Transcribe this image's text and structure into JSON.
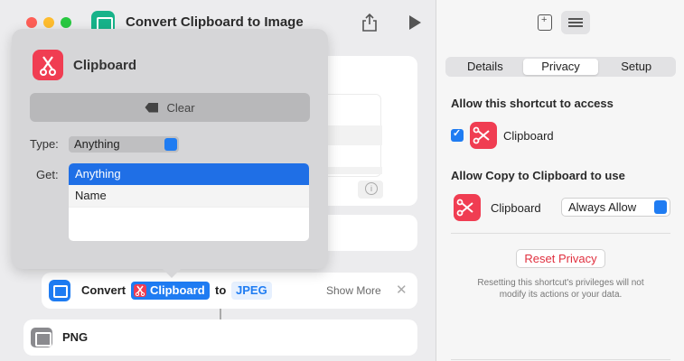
{
  "window": {
    "title": "Convert Clipboard to Image"
  },
  "popover": {
    "title": "Clipboard",
    "clear_label": "Clear",
    "type_label": "Type:",
    "type_value": "Anything",
    "get_label": "Get:",
    "get_options": [
      "Anything",
      "Name"
    ],
    "selected_option": "Anything"
  },
  "action": {
    "convert_label": "Convert",
    "clipboard_token": "Clipboard",
    "to_label": "to",
    "format_token": "JPEG",
    "show_more_label": "Show More"
  },
  "next_action": {
    "label": "PNG"
  },
  "inspector": {
    "tabs": [
      "Details",
      "Privacy",
      "Setup"
    ],
    "active_tab": "Privacy",
    "access_title": "Allow this shortcut to access",
    "access_item_label": "Clipboard",
    "access_checked": true,
    "copy_title": "Allow Copy to Clipboard to use",
    "copy_item_label": "Clipboard",
    "copy_permission_value": "Always Allow",
    "reset_label": "Reset Privacy",
    "reset_note": "Resetting this shortcut's privileges will not modify its actions or your data."
  },
  "icons": {
    "app": "shortcuts-image-icon",
    "share": "share-icon",
    "run": "play-icon",
    "clipboard": "scissors-icon",
    "library": "add-library-icon",
    "details": "sliders-icon"
  },
  "colors": {
    "accent": "#1f7cf2",
    "clipboard_red": "#f03d52",
    "app_green": "#17b38a",
    "reset_red": "#e0303f"
  }
}
